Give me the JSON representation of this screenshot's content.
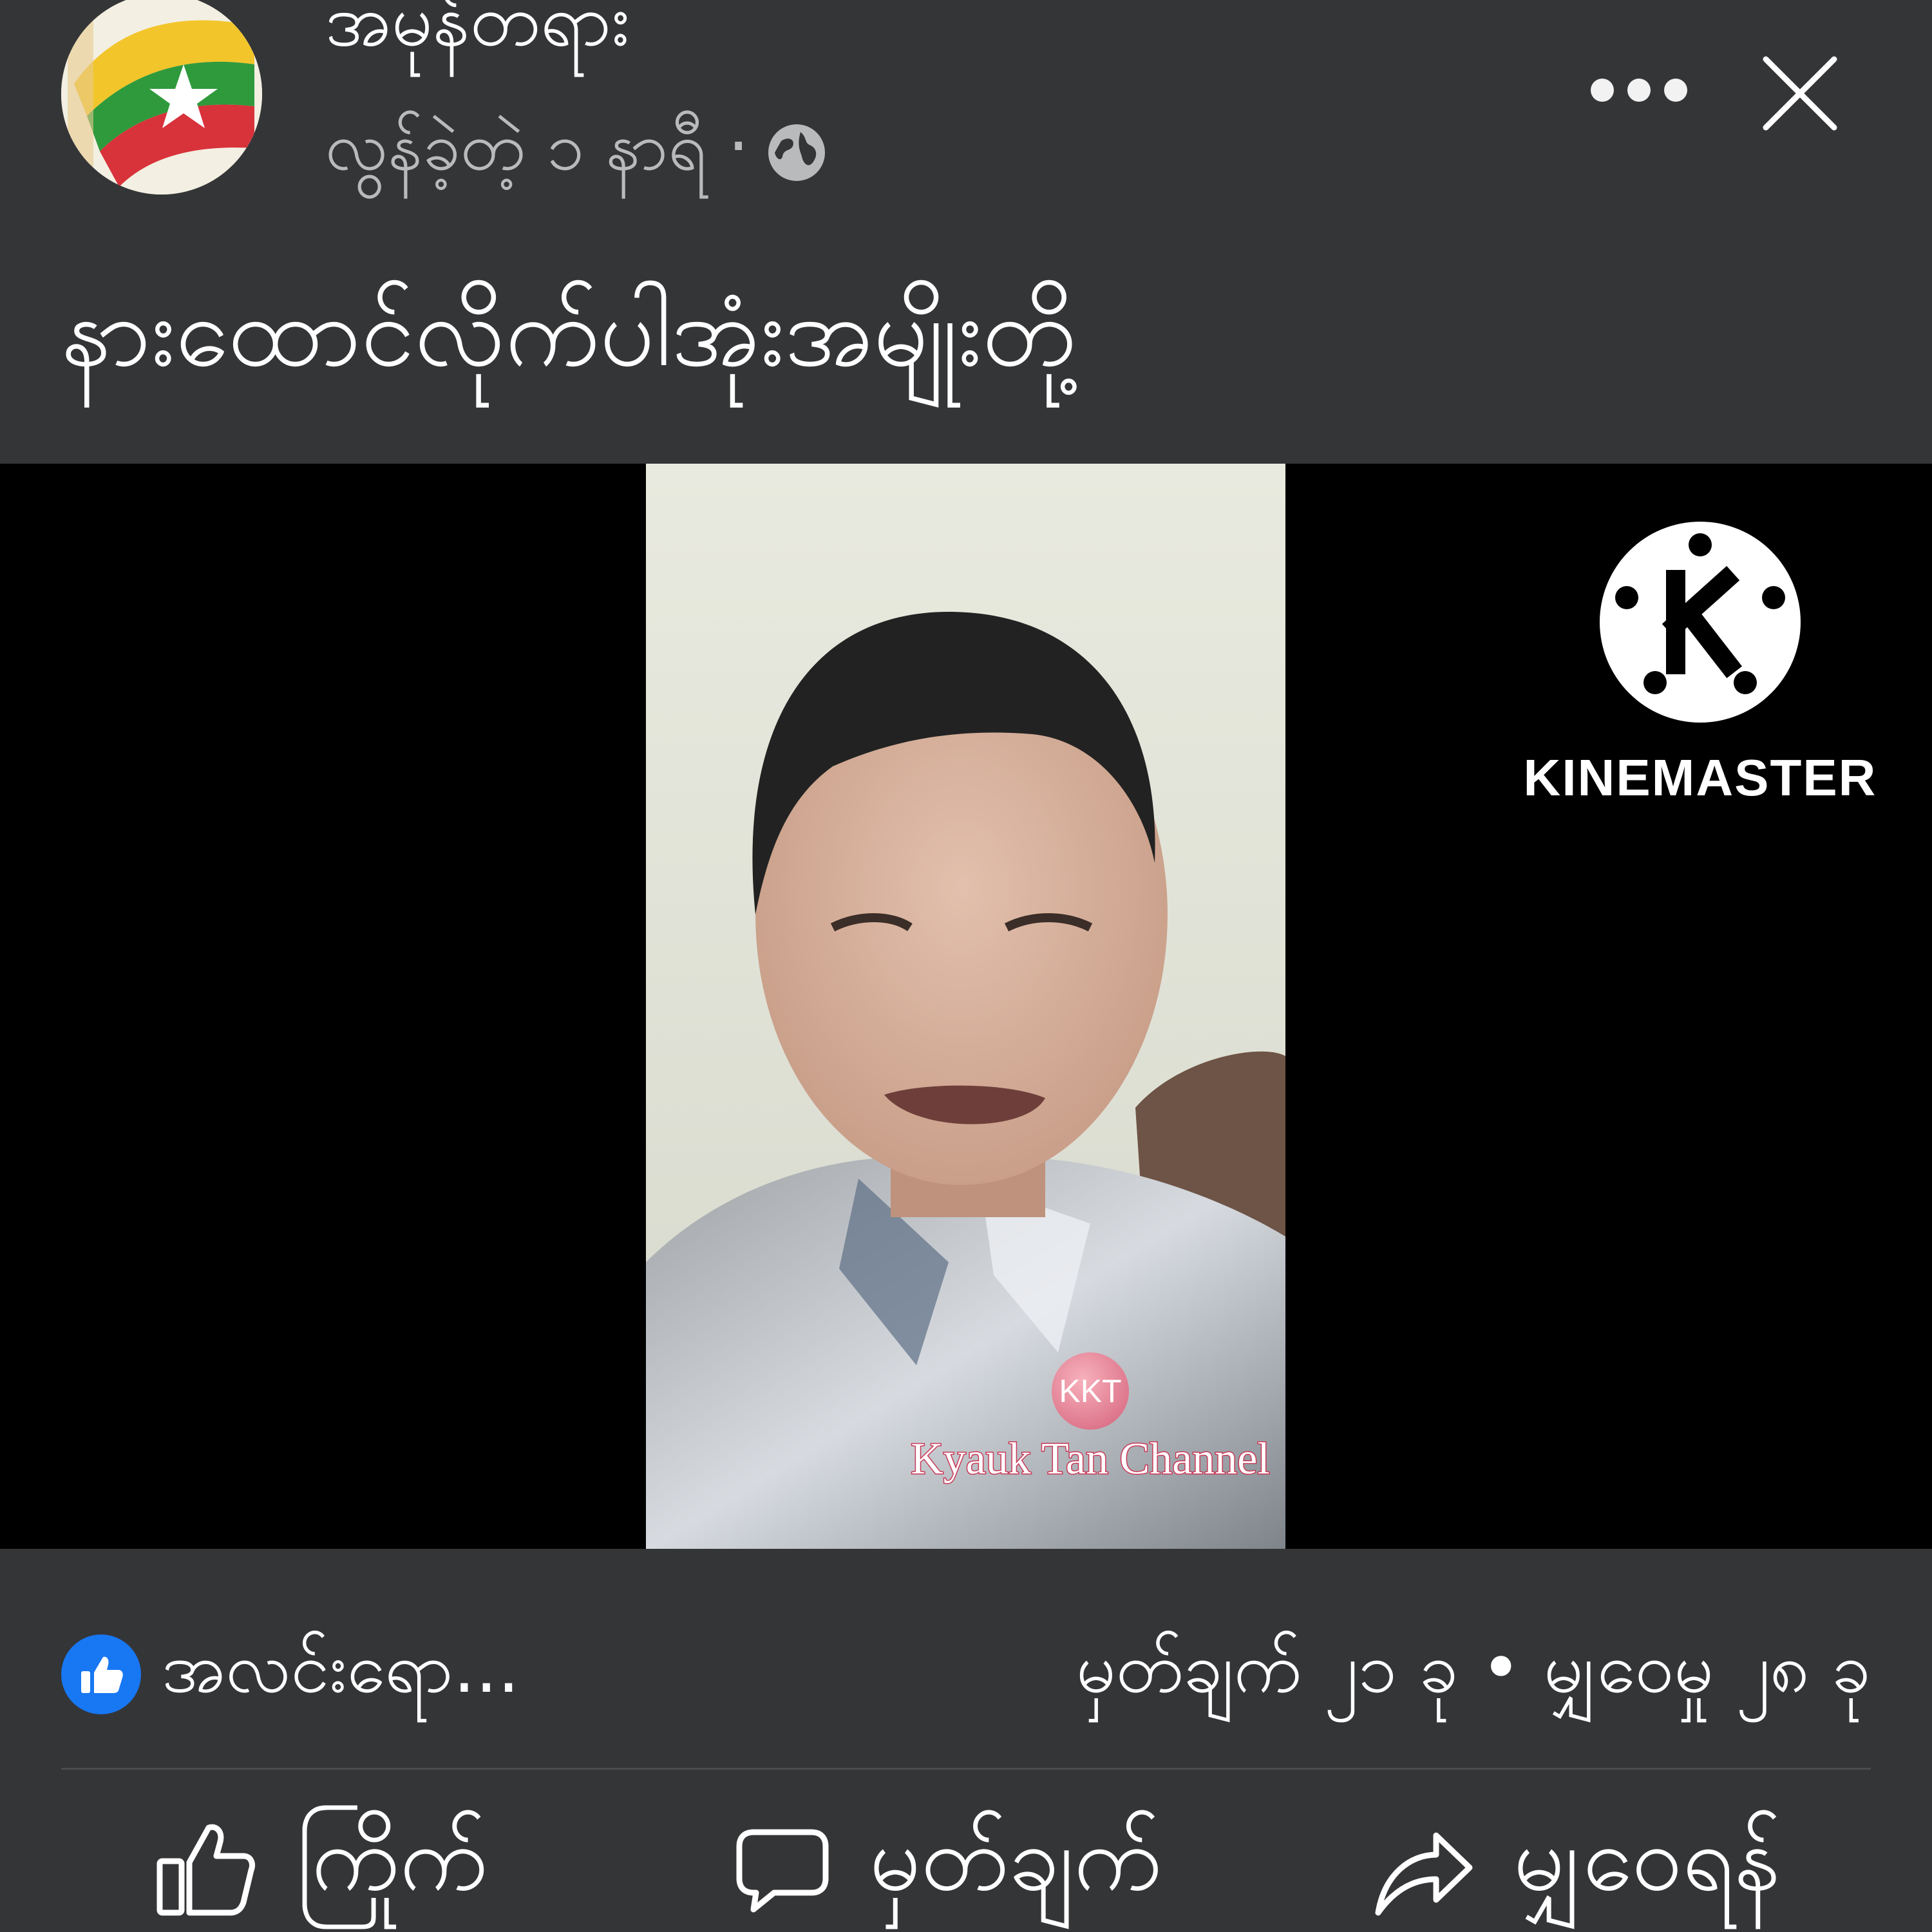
{
  "post": {
    "page_name": "အမုန်တရား",
    "time_ago": "လွန်ခဲ့တဲ့ ၁ နာရီ ·",
    "privacy_icon": "globe-icon",
    "text": "နားထောင်လိုက်ပါအုံးအမျိုးတို့"
  },
  "video": {
    "watermark": "KINEMASTER",
    "channel_badge": "KKT",
    "channel_name": "Kyauk Tan Channel"
  },
  "stats": {
    "reactions": "အလင်းရော...",
    "counts": "မှတ်ချက် ၂၁ ခု • မျှဝေမှု ၂၈ ခု"
  },
  "actions": {
    "like": "ကြိုက်",
    "comment": "မှတ်ချက်",
    "share": "မျှဝေရန်"
  },
  "colors": {
    "background": "#343537",
    "like_blue": "#1877f2",
    "video_bg": "#000000"
  }
}
